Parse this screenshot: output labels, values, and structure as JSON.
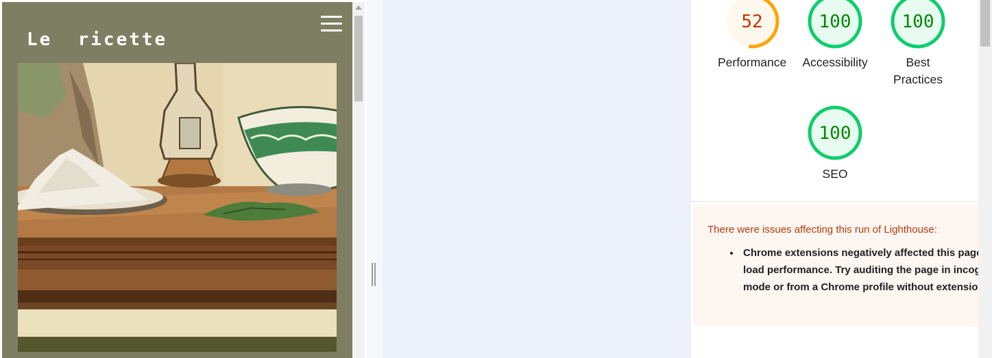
{
  "preview": {
    "logo_text": "Le  ricette",
    "menu_icon": "hamburger-menu-icon",
    "hero_image_desc": "illustrated kitchen still life"
  },
  "lighthouse": {
    "scores": [
      {
        "label": "Performance",
        "value": "52",
        "score": 52,
        "status": "average"
      },
      {
        "label": "Accessibility",
        "value": "100",
        "score": 100,
        "status": "pass"
      },
      {
        "label": "Best Practices",
        "value": "100",
        "score": 100,
        "status": "pass"
      },
      {
        "label": "SEO",
        "value": "100",
        "score": 100,
        "status": "pass"
      }
    ],
    "colors": {
      "average_ring": "#ffa400",
      "average_fill": "#fff8ec",
      "average_text": "#c33300",
      "pass_ring": "#0cce6b",
      "pass_fill": "#e8fbf1",
      "pass_text": "#008800"
    },
    "warning": {
      "title": "There were issues affecting this run of Lighthouse:",
      "items": [
        "Chrome extensions negatively affected this page's load performance. Try auditing the page in incognito mode or from a Chrome profile without extensions."
      ]
    }
  }
}
